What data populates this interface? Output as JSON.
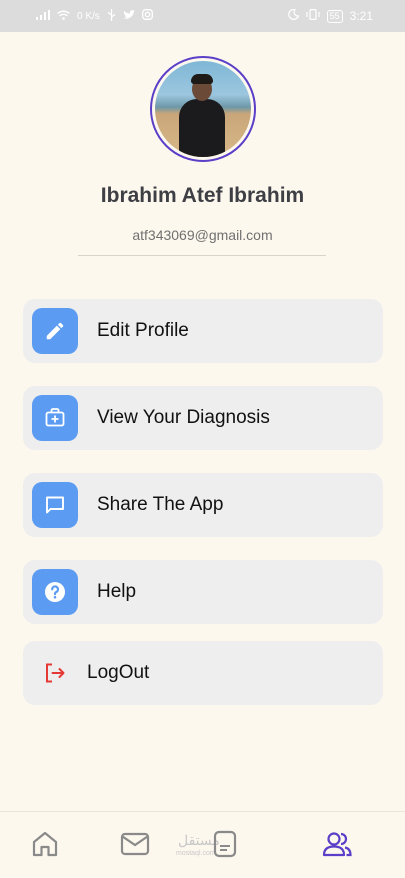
{
  "status_bar": {
    "net_speed": "0 K/s",
    "battery": "55",
    "time": "3:21"
  },
  "profile": {
    "name": "Ibrahim Atef Ibrahim",
    "email": "atf343069@gmail.com"
  },
  "menu": {
    "items": [
      {
        "label": "Edit Profile",
        "icon": "pencil-icon"
      },
      {
        "label": "View Your Diagnosis",
        "icon": "medical-case-icon"
      },
      {
        "label": "Share The App",
        "icon": "chat-bubble-icon"
      },
      {
        "label": "Help",
        "icon": "help-icon"
      }
    ],
    "logout": {
      "label": "LogOut",
      "icon": "logout-icon"
    }
  },
  "bottom_nav": {
    "items": [
      "home-icon",
      "mail-icon",
      "document-icon",
      "people-icon"
    ],
    "active_index": 3,
    "active_color": "#5b3fc8",
    "inactive_color": "#8a8a8a"
  },
  "watermark": {
    "text": "مستقل",
    "sub": "mostaql.com"
  },
  "colors": {
    "background": "#fdf8ee",
    "card": "#eeeeee",
    "icon_tile": "#5b9cf2",
    "logout_red": "#e53935",
    "avatar_ring": "#5b3fc8"
  }
}
